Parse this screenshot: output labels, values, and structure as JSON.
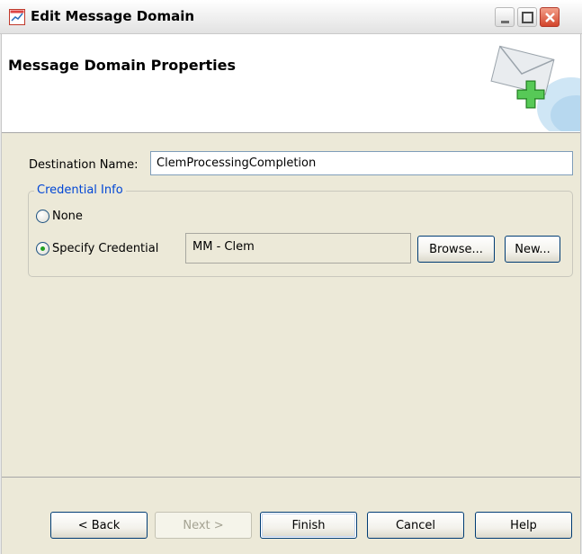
{
  "window": {
    "title": "Edit Message Domain",
    "icon": "chart-app-icon",
    "controls": {
      "minimize": "minimize-icon",
      "maximize": "maximize-icon",
      "close": "close-icon"
    }
  },
  "banner": {
    "title": "Message Domain Properties",
    "art": "envelope-add-icon"
  },
  "form": {
    "destination_label": "Destination Name:",
    "destination_value": "ClemProcessingCompletion",
    "credential_group": "Credential Info",
    "radio_none": "None",
    "radio_specify": "Specify Credential",
    "selected": "Specify Credential",
    "credential_value": "MM - Clem",
    "browse_label": "Browse...",
    "new_label": "New..."
  },
  "footer": {
    "back": "< Back",
    "next": "Next >",
    "finish": "Finish",
    "cancel": "Cancel",
    "help": "Help"
  },
  "colors": {
    "group_legend": "#0046d5",
    "dialog_bg": "#ece9d8",
    "radio_dot": "#21a121"
  }
}
